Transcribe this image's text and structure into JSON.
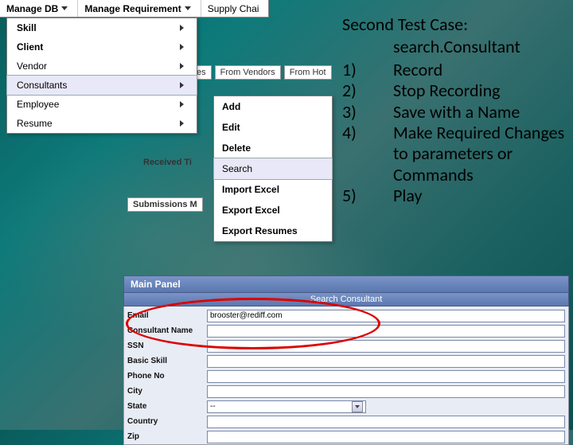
{
  "menubar": {
    "items": [
      {
        "label": "Manage DB"
      },
      {
        "label": "Manage Requirement"
      },
      {
        "label": "Supply Chai"
      }
    ]
  },
  "dropdown1": {
    "items": [
      {
        "label": "Skill"
      },
      {
        "label": "Client"
      },
      {
        "label": "Vendor"
      },
      {
        "label": "Consultants"
      },
      {
        "label": "Employee"
      },
      {
        "label": "Resume"
      }
    ]
  },
  "dropdown2": {
    "items": [
      {
        "label": "Add"
      },
      {
        "label": "Edit"
      },
      {
        "label": "Delete"
      },
      {
        "label": "Search"
      },
      {
        "label": "Import Excel"
      },
      {
        "label": "Export Excel"
      },
      {
        "label": "Export Resumes"
      }
    ]
  },
  "bg": {
    "tab_es": "es",
    "tab_from_vendors": "From Vendors",
    "tab_from_hot": "From Hot",
    "received_label": "Received Ti",
    "submissions_label": "Submissions M"
  },
  "overlay": {
    "title": "Second Test Case:",
    "subtitle": "search.Consultant",
    "steps": [
      {
        "n": "1)",
        "t": "Record"
      },
      {
        "n": "2)",
        "t": "Stop Recording"
      },
      {
        "n": "3)",
        "t": "Save with a Name"
      },
      {
        "n": "4)",
        "t": "Make Required Changes to parameters or Commands"
      },
      {
        "n": "5)",
        "t": "Play"
      }
    ]
  },
  "form": {
    "main_title": "Main Panel",
    "sub_title": "Search Consultant",
    "rows": [
      {
        "label": "Email",
        "value": "brooster@rediff.com"
      },
      {
        "label": "Consultant Name",
        "value": ""
      },
      {
        "label": "SSN",
        "value": ""
      },
      {
        "label": "Basic Skill",
        "value": ""
      },
      {
        "label": "Phone No",
        "value": ""
      },
      {
        "label": "City",
        "value": ""
      },
      {
        "label": "State",
        "value": "--"
      },
      {
        "label": "Country",
        "value": ""
      },
      {
        "label": "Zip",
        "value": ""
      }
    ]
  }
}
